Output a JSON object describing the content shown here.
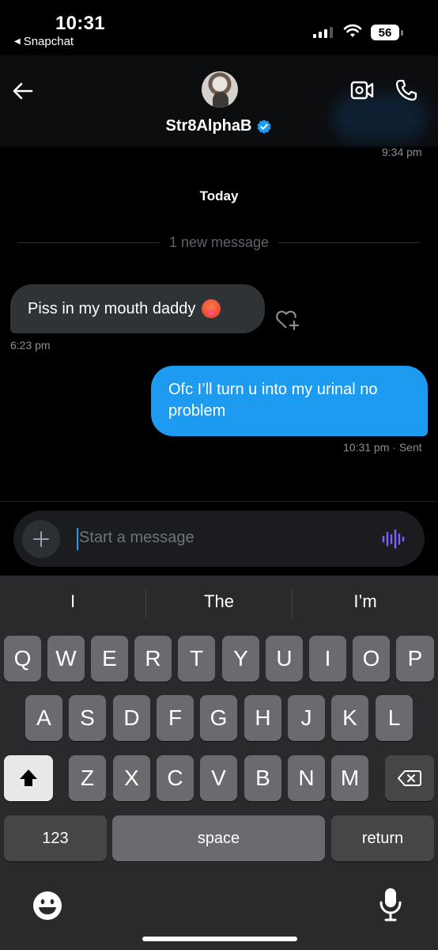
{
  "status_bar": {
    "time": "10:31",
    "back_app": "Snapchat",
    "battery": "56"
  },
  "header": {
    "username": "Str8AlphaB",
    "icons": [
      "back-arrow-icon",
      "video-call-icon",
      "phone-icon",
      "verified-badge-icon"
    ],
    "last_timestamp": "9:34 pm"
  },
  "conversation": {
    "date_label": "Today",
    "new_messages_label": "1 new message",
    "incoming": {
      "text": "Piss in my mouth daddy",
      "time": "6:23 pm"
    },
    "outgoing": {
      "text": "Ofc I’ll turn u into my urinal no problem",
      "time": "10:31 pm",
      "status": "· Sent"
    }
  },
  "composer": {
    "placeholder": "Start a message",
    "accent": "#1d9bf0"
  },
  "keyboard": {
    "suggestions": [
      "I",
      "The",
      "I’m"
    ],
    "row1": [
      "Q",
      "W",
      "E",
      "R",
      "T",
      "Y",
      "U",
      "I",
      "O",
      "P"
    ],
    "row2": [
      "A",
      "S",
      "D",
      "F",
      "G",
      "H",
      "J",
      "K",
      "L"
    ],
    "row3": [
      "Z",
      "X",
      "C",
      "V",
      "B",
      "N",
      "M"
    ],
    "numbers_label": "123",
    "space_label": "space",
    "return_label": "return"
  }
}
